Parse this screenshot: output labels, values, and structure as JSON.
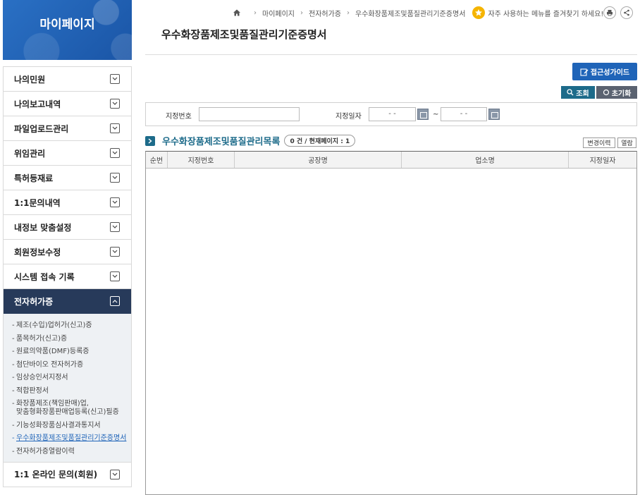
{
  "sidebar": {
    "title": "마이페이지",
    "items": [
      {
        "label": "나의민원"
      },
      {
        "label": "나의보고내역"
      },
      {
        "label": "파일업로드관리"
      },
      {
        "label": "위임관리"
      },
      {
        "label": "특허등재료"
      },
      {
        "label": "1:1문의내역"
      },
      {
        "label": "내정보 맞춤설정"
      },
      {
        "label": "회원정보수정"
      },
      {
        "label": "시스템 접속 기록"
      },
      {
        "label": "전자허가증"
      }
    ],
    "sub_items": [
      "제조(수입)업허가(신고)증",
      "품목허가(신고)증",
      "원료의약품(DMF)등록증",
      "첨단바이오 전자허가증",
      "임상승인서지정서",
      "적합판정서",
      "화장품제조(책임판매)업,\n맞춤형화장품판매업등록(신고)필증",
      "기능성화장품심사결과통지서",
      "우수화장품제조및품질관리기준증명서",
      "전자허가증열람이력"
    ],
    "last_item": "1:1 온라인 문의(회원)"
  },
  "breadcrumb": {
    "items": [
      "마이페이지",
      "전자허가증",
      "우수화장품제조및품질관리기준증명서"
    ],
    "favorite_text": "자주 사용하는 메뉴를 즐겨찾기 하세요!"
  },
  "page": {
    "title": "우수화장품제조및품질관리기준증명서",
    "guide_button": "접근성가이드",
    "search_button": "조회",
    "reset_button": "초기화"
  },
  "search": {
    "number_label": "지정번호",
    "number_value": "",
    "date_label": "지정일자",
    "date_from": "-   -",
    "date_to": "-   -",
    "tilde": "~"
  },
  "list": {
    "title": "우수화장품제조및품질관리목록",
    "count_text": "0 건 / 현재페이지 : 1",
    "history_button": "변경이력",
    "view_button": "열람",
    "columns": [
      "순번",
      "지정번호",
      "공장명",
      "업소명",
      "지정일자"
    ]
  },
  "colors": {
    "brand_blue": "#1f64b8",
    "active_menu": "#273a5a",
    "teal": "#1d6b8a"
  }
}
